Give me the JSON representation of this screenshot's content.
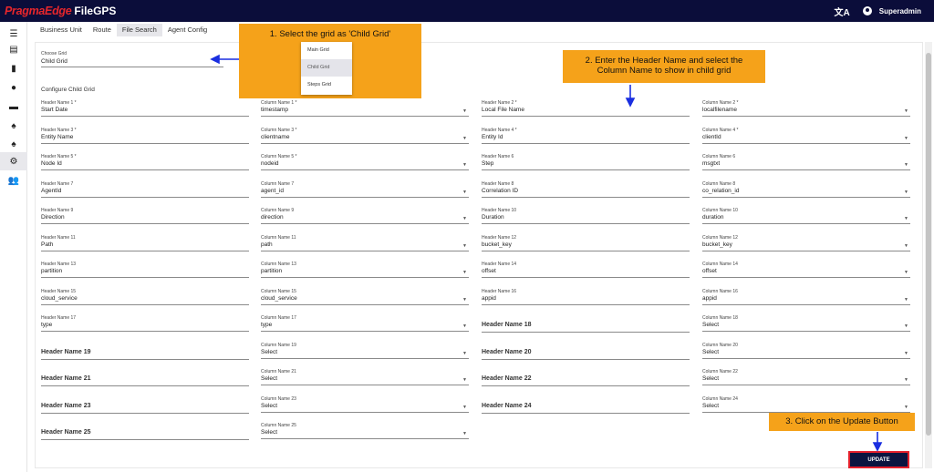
{
  "app": {
    "brand_red": "PragmaEdge",
    "brand_white": "FileGPS",
    "user": "Superadmin"
  },
  "tabs": [
    {
      "label": "Business Unit"
    },
    {
      "label": "Route"
    },
    {
      "label": "File Search"
    },
    {
      "label": "Agent Config"
    }
  ],
  "choose_grid": {
    "label": "Choose Grid",
    "value": "Child Grid"
  },
  "grid_options": [
    "Main Grid",
    "Child Grid",
    "Steps Grid"
  ],
  "section_title": "Configure Child Grid",
  "rows": [
    [
      {
        "label": "Header Name 1 *",
        "value": "Start Date",
        "type": "text"
      },
      {
        "label": "Column Name 1 *",
        "value": "timestamp",
        "type": "select"
      },
      {
        "label": "Header Name 2 *",
        "value": "Local File Name",
        "type": "text"
      },
      {
        "label": "Column Name 2 *",
        "value": "localfilename",
        "type": "select"
      }
    ],
    [
      {
        "label": "Header Name 3 *",
        "value": "Entity Name",
        "type": "text"
      },
      {
        "label": "Column Name 3 *",
        "value": "clientname",
        "type": "select"
      },
      {
        "label": "Header Name 4 *",
        "value": "Entity Id",
        "type": "text"
      },
      {
        "label": "Column Name 4 *",
        "value": "clientId",
        "type": "select"
      }
    ],
    [
      {
        "label": "Header Name 5 *",
        "value": "Node Id",
        "type": "text"
      },
      {
        "label": "Column Name 5 *",
        "value": "nodeid",
        "type": "select"
      },
      {
        "label": "Header Name 6",
        "value": "Step",
        "type": "text"
      },
      {
        "label": "Column Name 6",
        "value": "msgtxt",
        "type": "select"
      }
    ],
    [
      {
        "label": "Header Name 7",
        "value": "AgentId",
        "type": "text"
      },
      {
        "label": "Column Name 7",
        "value": "agent_id",
        "type": "select"
      },
      {
        "label": "Header Name 8",
        "value": "Correlation ID",
        "type": "text"
      },
      {
        "label": "Column Name 8",
        "value": "co_relation_id",
        "type": "select"
      }
    ],
    [
      {
        "label": "Header Name 9",
        "value": "Direction",
        "type": "text"
      },
      {
        "label": "Column Name 9",
        "value": "direction",
        "type": "select"
      },
      {
        "label": "Header Name 10",
        "value": "Duration",
        "type": "text"
      },
      {
        "label": "Column Name 10",
        "value": "duration",
        "type": "select"
      }
    ],
    [
      {
        "label": "Header Name 11",
        "value": "Path",
        "type": "text"
      },
      {
        "label": "Column Name 11",
        "value": "path",
        "type": "select"
      },
      {
        "label": "Header Name 12",
        "value": "bucket_key",
        "type": "text"
      },
      {
        "label": "Column Name 12",
        "value": "bucket_key",
        "type": "select"
      }
    ],
    [
      {
        "label": "Header Name 13",
        "value": "partition",
        "type": "text"
      },
      {
        "label": "Column Name 13",
        "value": "partition",
        "type": "select"
      },
      {
        "label": "Header Name 14",
        "value": "offset",
        "type": "text"
      },
      {
        "label": "Column Name 14",
        "value": "offset",
        "type": "select"
      }
    ],
    [
      {
        "label": "Header Name 15",
        "value": "cloud_service",
        "type": "text"
      },
      {
        "label": "Column Name 15",
        "value": "cloud_service",
        "type": "select"
      },
      {
        "label": "Header Name 16",
        "value": "appid",
        "type": "text"
      },
      {
        "label": "Column Name 16",
        "value": "appid",
        "type": "select"
      }
    ],
    [
      {
        "label": "Header Name 17",
        "value": "type",
        "type": "text"
      },
      {
        "label": "Column Name 17",
        "value": "type",
        "type": "select"
      },
      {
        "label": "",
        "value": "Header Name 18",
        "type": "empty"
      },
      {
        "label": "Column Name 18",
        "value": "Select",
        "type": "select"
      }
    ],
    [
      {
        "label": "",
        "value": "Header Name 19",
        "type": "empty"
      },
      {
        "label": "Column Name 19",
        "value": "Select",
        "type": "select"
      },
      {
        "label": "",
        "value": "Header Name 20",
        "type": "empty"
      },
      {
        "label": "Column Name 20",
        "value": "Select",
        "type": "select"
      }
    ],
    [
      {
        "label": "",
        "value": "Header Name 21",
        "type": "empty"
      },
      {
        "label": "Column Name 21",
        "value": "Select",
        "type": "select"
      },
      {
        "label": "",
        "value": "Header Name 22",
        "type": "empty"
      },
      {
        "label": "Column Name 22",
        "value": "Select",
        "type": "select"
      }
    ],
    [
      {
        "label": "",
        "value": "Header Name 23",
        "type": "empty"
      },
      {
        "label": "Column Name 23",
        "value": "Select",
        "type": "select"
      },
      {
        "label": "",
        "value": "Header Name 24",
        "type": "empty"
      },
      {
        "label": "Column Name 24",
        "value": "Select",
        "type": "select"
      }
    ],
    [
      {
        "label": "",
        "value": "Header Name 25",
        "type": "empty"
      },
      {
        "label": "Column Name 25",
        "value": "Select",
        "type": "select"
      }
    ]
  ],
  "update_label": "UPDATE",
  "callouts": {
    "step1": "1. Select the grid as 'Child Grid'",
    "step2_line1": "2. Enter the Header Name and select the",
    "step2_line2": "Column Name to show in child grid",
    "step3": "3. Click on the Update Button"
  },
  "colors": {
    "topbar": "#0b0d3a",
    "brand_red": "#e8262b",
    "callout": "#f5a21a",
    "arrow": "#1a2fe0",
    "update_button": "#0b1440",
    "update_border": "#e3202c"
  },
  "icons": [
    "menu-icon",
    "files-icon",
    "bar-chart-icon",
    "account-icon",
    "report-icon",
    "bell-alert-icon",
    "bell-icon",
    "settings-box-icon",
    "group-icon",
    "translate-icon",
    "user-circle-icon"
  ]
}
